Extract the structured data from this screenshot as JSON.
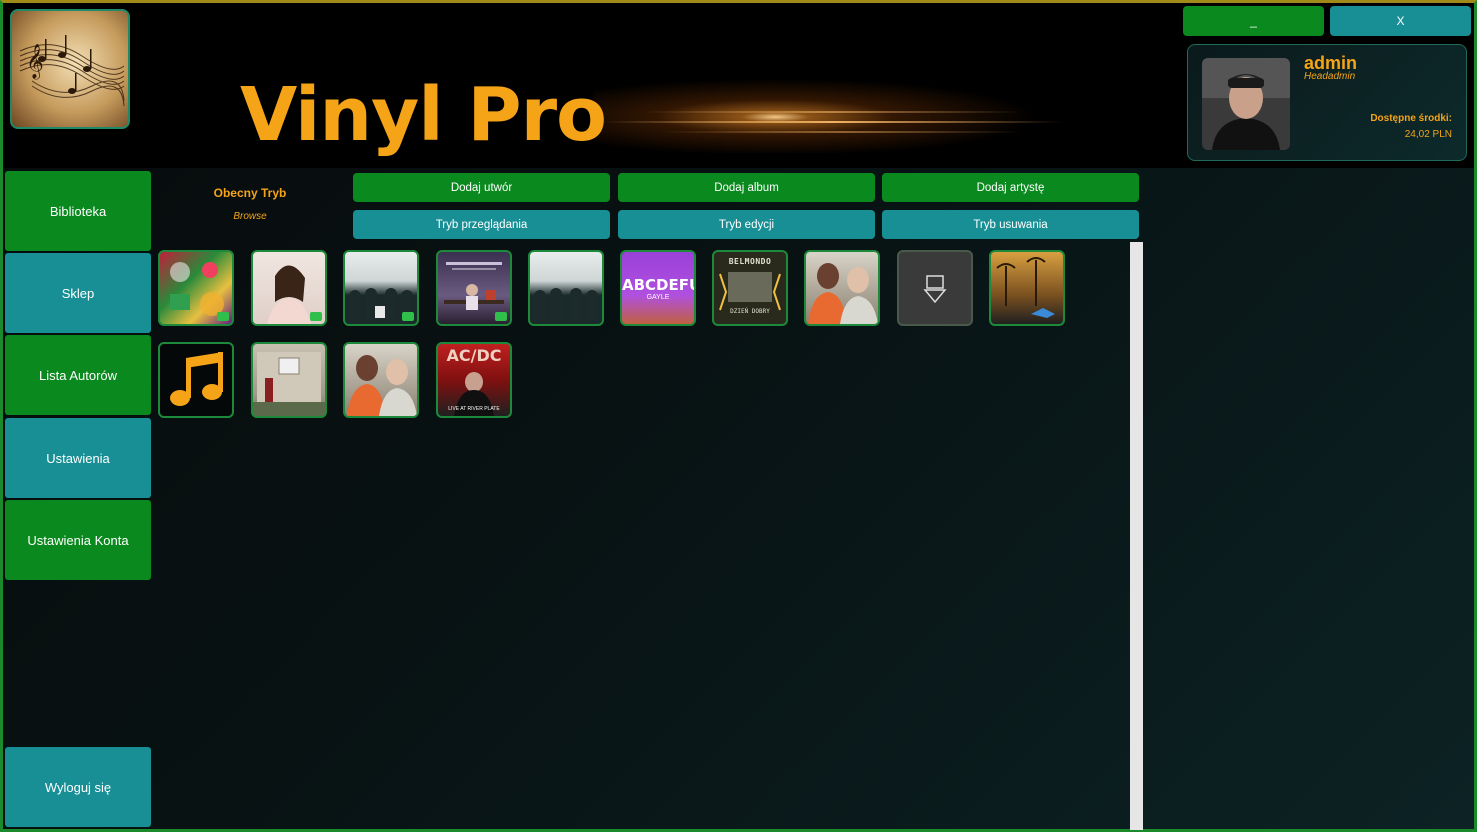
{
  "app": {
    "title": "Vinyl Pro"
  },
  "window_controls": {
    "minimize_label": "_",
    "close_label": "X"
  },
  "user": {
    "name": "admin",
    "role": "Headadmin",
    "funds_label": "Dostępne środki:",
    "funds_value": "24,02 PLN"
  },
  "sidebar": {
    "items": [
      {
        "label": "Biblioteka"
      },
      {
        "label": "Sklep"
      },
      {
        "label": "Lista Autorów"
      },
      {
        "label": "Ustawienia"
      },
      {
        "label": "Ustawienia Konta"
      }
    ],
    "logout_label": "Wyloguj się"
  },
  "mode": {
    "title": "Obecny Tryb",
    "value": "Browse"
  },
  "actions": {
    "add_track": "Dodaj utwór",
    "add_album": "Dodaj album",
    "add_artist": "Dodaj artystę",
    "browse_mode": "Tryb przeglądania",
    "edit_mode": "Tryb edycji",
    "delete_mode": "Tryb usuwania"
  },
  "albums": {
    "row1": [
      {
        "cover": "colorful-collage"
      },
      {
        "cover": "woman-portrait"
      },
      {
        "cover": "hooded-crowd"
      },
      {
        "cover": "studio-scene"
      },
      {
        "cover": "hooded-crowd"
      },
      {
        "cover": "abcdefu-text",
        "text": "ABCDEFU",
        "subtext": "GAYLE"
      },
      {
        "cover": "belmondo-text",
        "text": "BELMONDO",
        "subtext": "DZIEŃ DOBRY"
      },
      {
        "cover": "two-men"
      },
      {
        "cover": "placeholder-icon"
      },
      {
        "cover": "palm-sunset"
      }
    ],
    "row2": [
      {
        "cover": "music-note-icon"
      },
      {
        "cover": "house-facade"
      },
      {
        "cover": "two-men"
      },
      {
        "cover": "acdc-text",
        "text": "AC/DC",
        "subtext": "LIVE AT RIVER PLATE"
      }
    ]
  },
  "colors": {
    "title_orange": "#f5a418",
    "green_button": "#0a8a1e",
    "teal_button": "#178f95"
  }
}
